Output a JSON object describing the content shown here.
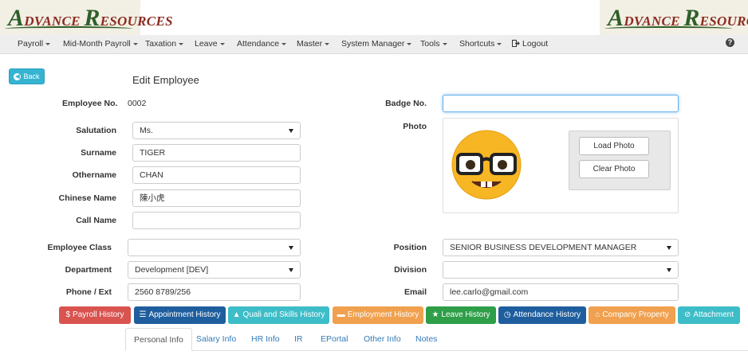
{
  "header": {
    "logo_left": "ADVANCE RESOURCES",
    "logo_right": "ADVANCE RESOURCES",
    "logo_a": "A",
    "logo_dvance": "DVANCE ",
    "logo_r": "R",
    "logo_esources": "ESOURCES"
  },
  "nav": {
    "items": [
      "Payroll",
      "Mid-Month Payroll",
      "Taxation",
      "Leave",
      "Attendance",
      "Master",
      "System Manager",
      "Tools",
      "Shortcuts"
    ],
    "logout": "Logout",
    "help_glyph": "?"
  },
  "back_button": "Back",
  "page_title": "Edit Employee",
  "form": {
    "employee_no": {
      "label": "Employee No.",
      "value": "0002"
    },
    "badge_no": {
      "label": "Badge No.",
      "value": ""
    },
    "salutation": {
      "label": "Salutation",
      "value": "Ms."
    },
    "surname": {
      "label": "Surname",
      "value": "TIGER"
    },
    "othername": {
      "label": "Othername",
      "value": "CHAN"
    },
    "chinese_name": {
      "label": "Chinese Name",
      "value": "陳小虎"
    },
    "call_name": {
      "label": "Call Name",
      "value": ""
    },
    "photo": {
      "label": "Photo",
      "load_button": "Load Photo",
      "clear_button": "Clear Photo",
      "image": "nerd-face-emoji"
    },
    "employee_class": {
      "label": "Employee Class",
      "value": ""
    },
    "position": {
      "label": "Position",
      "value": "SENIOR BUSINESS DEVELOPMENT MANAGER"
    },
    "department": {
      "label": "Department",
      "value": "Development [DEV]"
    },
    "division": {
      "label": "Division",
      "value": ""
    },
    "phone": {
      "label": "Phone / Ext",
      "value": "2560 8789/256"
    },
    "email": {
      "label": "Email",
      "value": "lee.carlo@gmail.com"
    }
  },
  "action_buttons": [
    {
      "label": "Payroll History",
      "icon": "dollar-icon",
      "color": "#d9534f"
    },
    {
      "label": "Appointment History",
      "icon": "list-icon",
      "color": "#1f5e9e"
    },
    {
      "label": "Quali and Skills History",
      "icon": "graduation-cap-icon",
      "color": "#3dbdc8"
    },
    {
      "label": "Employment History",
      "icon": "briefcase-icon",
      "color": "#f0a04e"
    },
    {
      "label": "Leave History",
      "icon": "star-icon",
      "color": "#2e9e48"
    },
    {
      "label": "Attendance History",
      "icon": "clock-icon",
      "color": "#1f5e9e"
    },
    {
      "label": "Company Property",
      "icon": "home-icon",
      "color": "#f0a04e"
    },
    {
      "label": "Attachment",
      "icon": "paperclip-icon",
      "color": "#3dbdc8"
    }
  ],
  "tabs": [
    "Personal Info",
    "Salary Info",
    "HR Info",
    "IR",
    "EPortal",
    "Other Info",
    "Notes"
  ],
  "active_tab": "Personal Info"
}
